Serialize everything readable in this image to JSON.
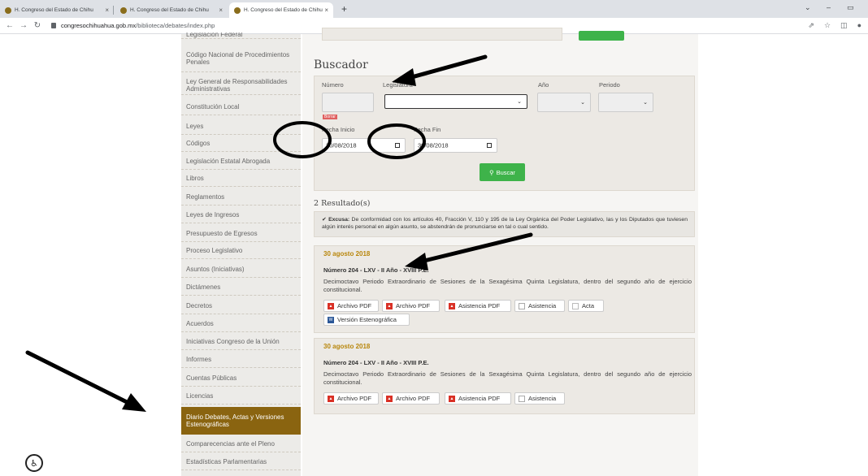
{
  "browser": {
    "tabs": [
      {
        "title": "H. Congreso del Estado de Chihu"
      },
      {
        "title": "H. Congreso del Estado de Chihu"
      },
      {
        "title": "H. Congreso del Estado de Chihu"
      }
    ],
    "new_tab": "+",
    "url_host": "congresochihuahua.gob.mx",
    "url_path": "/biblioteca/debates/index.php"
  },
  "sidebar": {
    "items": [
      {
        "label": "Legislación Federal"
      },
      {
        "label": "Código Nacional de Procedimientos Penales"
      },
      {
        "label": "Ley General de Responsabilidades Administrativas"
      },
      {
        "label": "Constitución Local"
      },
      {
        "label": "Leyes"
      },
      {
        "label": "Códigos"
      },
      {
        "label": "Legislación Estatal Abrogada"
      },
      {
        "label": "Libros"
      },
      {
        "label": "Reglamentos"
      },
      {
        "label": "Leyes de Ingresos"
      },
      {
        "label": "Presupuesto de Egresos"
      },
      {
        "label": "Proceso Legislativo"
      },
      {
        "label": "Asuntos (Iniciativas)"
      },
      {
        "label": "Dictámenes"
      },
      {
        "label": "Decretos"
      },
      {
        "label": "Acuerdos"
      },
      {
        "label": "Iniciativas Congreso de la Unión"
      },
      {
        "label": "Informes"
      },
      {
        "label": "Cuentas Públicas"
      },
      {
        "label": "Licencias"
      },
      {
        "label": "Diario Debates, Actas y Versiones Estenográficas"
      },
      {
        "label": "Comparecencias ante el Pleno"
      },
      {
        "label": "Estadísticas Parlamentarias"
      }
    ]
  },
  "search": {
    "title": "Buscador",
    "numero_label": "Número",
    "legislatura_label": "Legislatura",
    "anio_label": "Año",
    "periodo_label": "Periodo",
    "borrar": "Borrar",
    "fecha_inicio_label": "Fecha Inicio",
    "fecha_fin_label": "Fecha Fin",
    "fecha_inicio_value": "30/08/2018",
    "fecha_fin_value": "30/08/2018",
    "search_button": "Buscar"
  },
  "results": {
    "count_label": "2 Resultado(s)",
    "excusa_title": "Excusa:",
    "excusa_text": "De conformidad con los artículos 40, Fracción V, 110 y 195 de la Ley Orgánica del Poder Legislativo, las y los Diputados que tuviesen algún interés personal en algún asunto, se abstendrán de pronunciarse en tal o cual sentido.",
    "items": [
      {
        "date": "30 agosto 2018",
        "number": "Número 204 - LXV - II Año - XVIII P.E.",
        "description": "Decimoctavo Periodo Extraordinario de Sesiones de la Sexagésima Quinta Legislatura, dentro del segundo año de ejercicio constitucional.",
        "buttons": [
          "Archivo PDF",
          "Archivo PDF",
          "Asistencia PDF",
          "Asistencia",
          "Acta",
          "Versión Estenográfica"
        ]
      },
      {
        "date": "30 agosto 2018",
        "number": "Número 204 - LXV - II Año - XVIII P.E.",
        "description": "Decimoctavo Periodo Extraordinario de Sesiones de la Sexagésima Quinta Legislatura, dentro del segundo año de ejercicio constitucional.",
        "buttons": [
          "Archivo PDF",
          "Archivo PDF",
          "Asistencia PDF",
          "Asistencia"
        ]
      }
    ]
  }
}
